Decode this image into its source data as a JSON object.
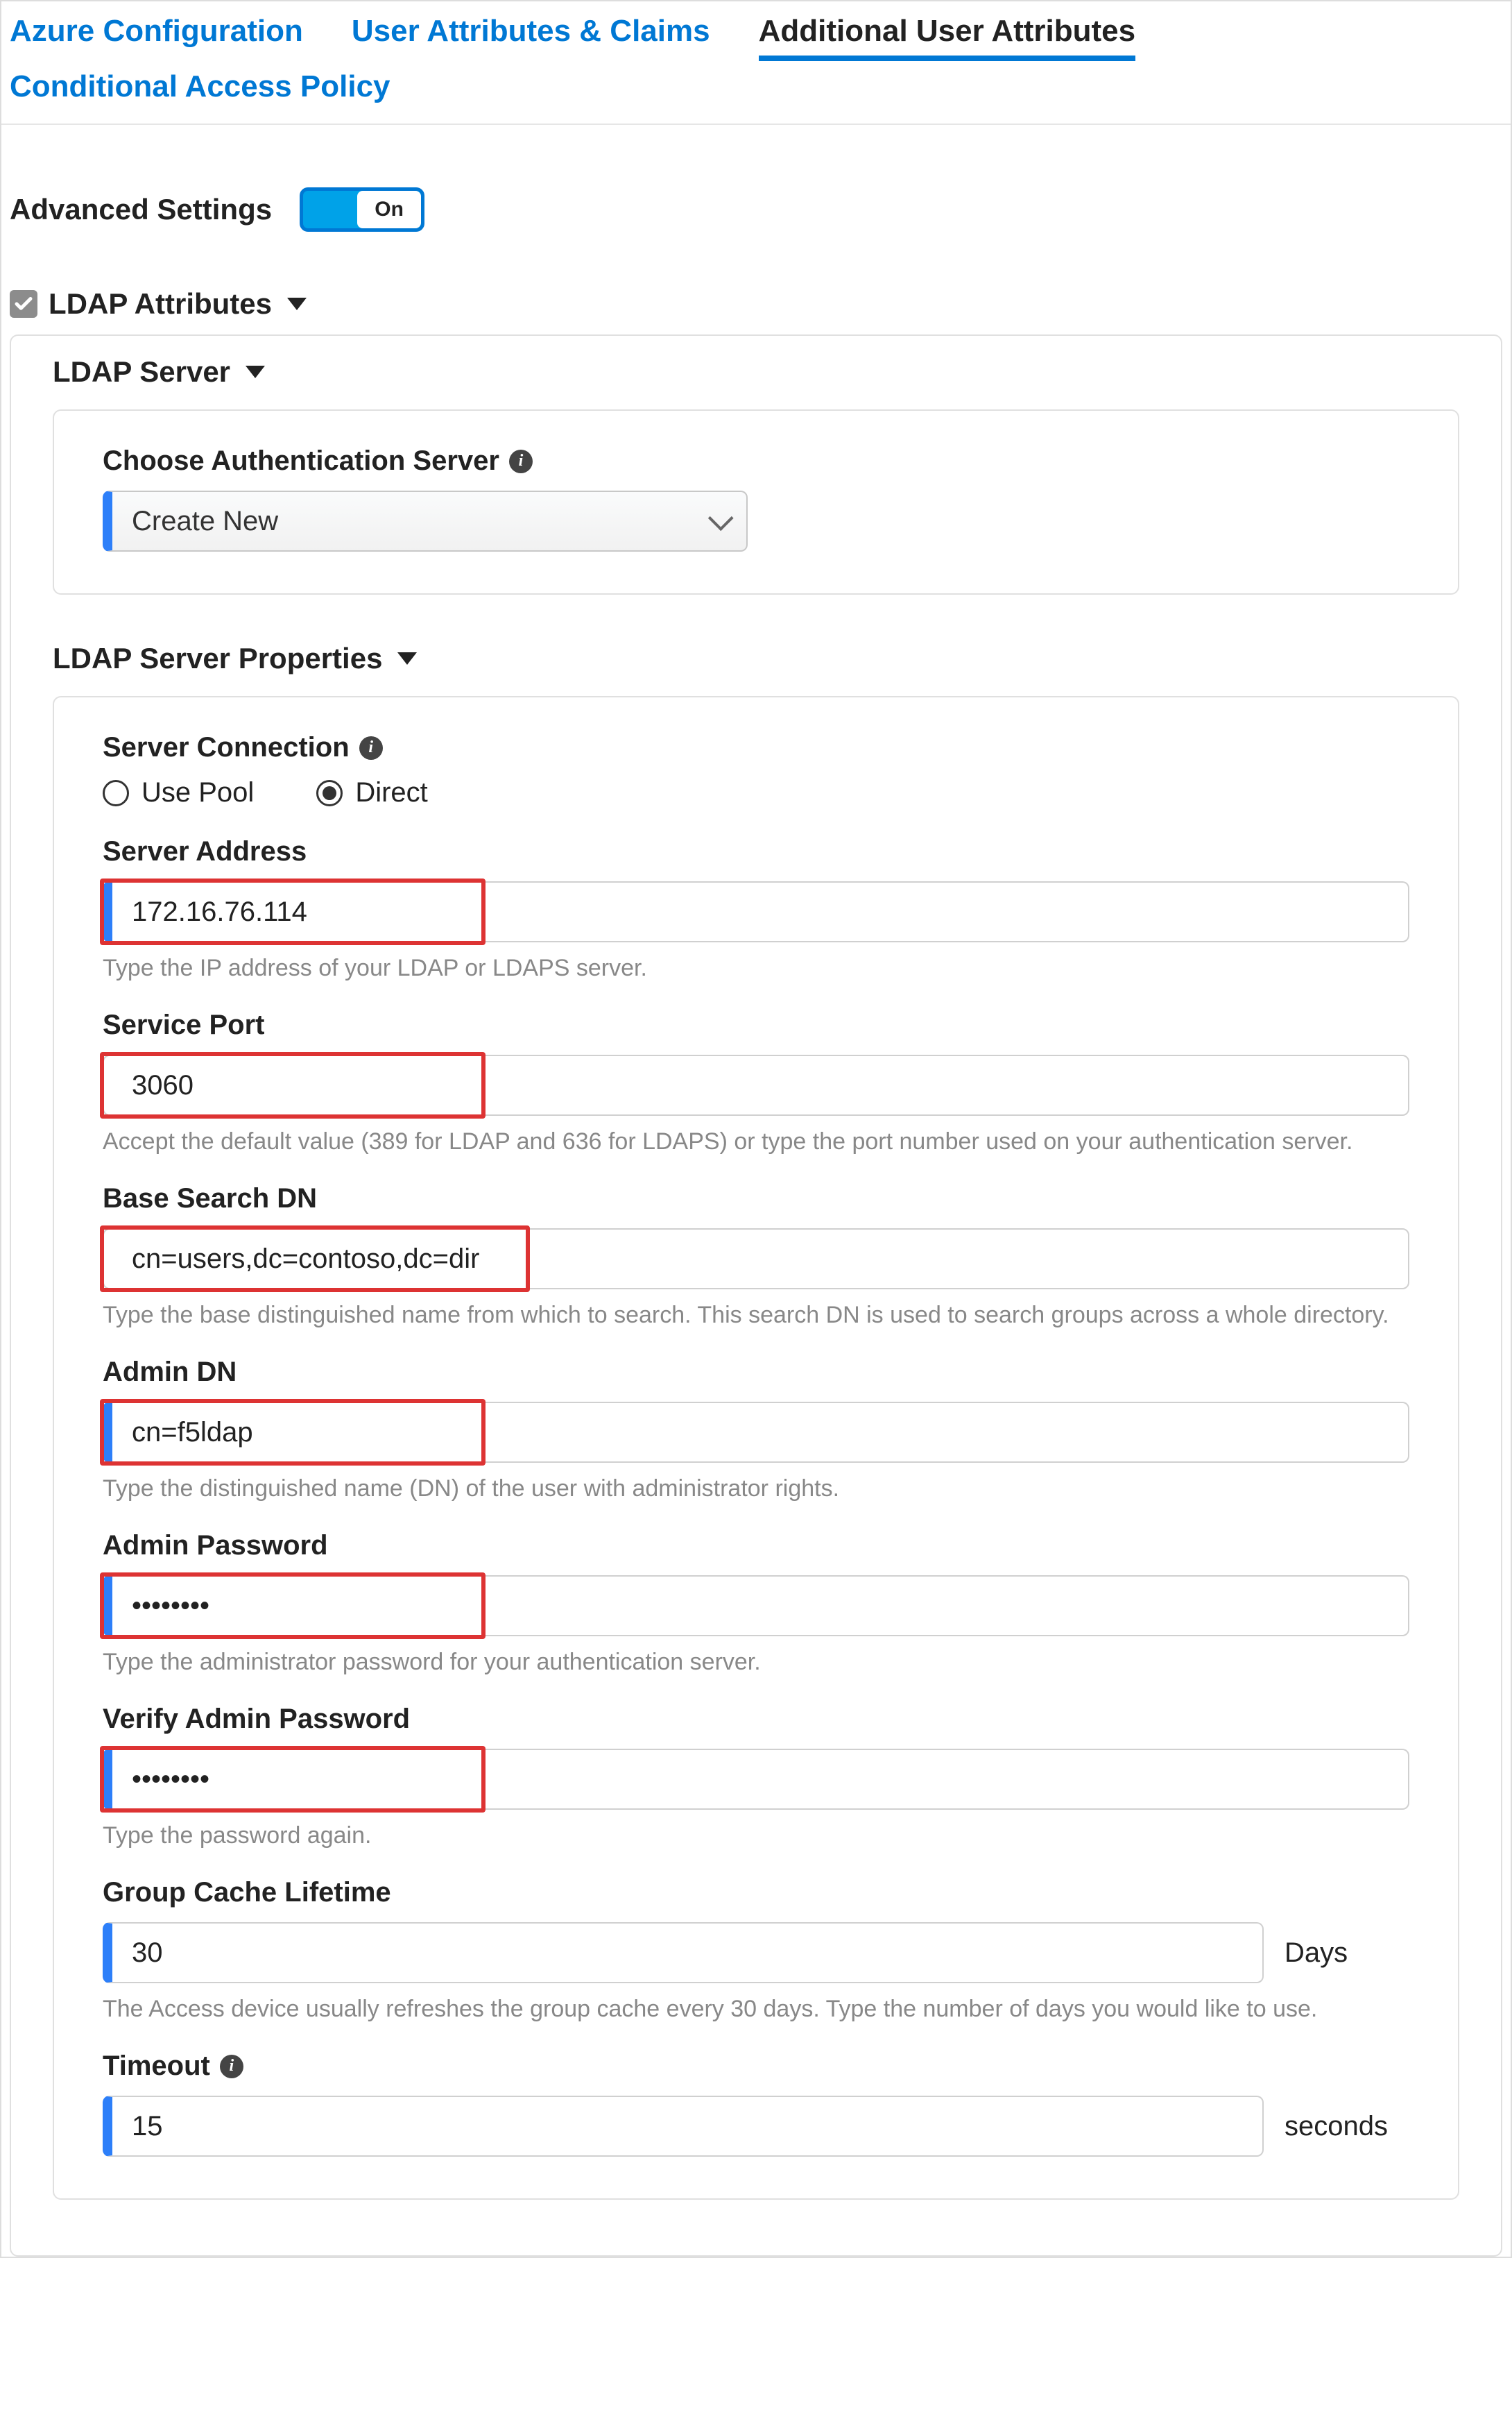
{
  "tabs": {
    "azure": "Azure Configuration",
    "claims": "User Attributes & Claims",
    "additional": "Additional User Attributes",
    "cap": "Conditional Access Policy"
  },
  "advanced": {
    "label": "Advanced Settings",
    "toggle_text": "On"
  },
  "ldap": {
    "title": "LDAP Attributes",
    "server_section": "LDAP Server",
    "auth_label": "Choose Authentication Server",
    "auth_selected": "Create New",
    "props_section": "LDAP Server Properties",
    "conn_label": "Server Connection",
    "conn_pool": "Use Pool",
    "conn_direct": "Direct",
    "addr_label": "Server Address",
    "addr_value": "172.16.76.114",
    "addr_help": "Type the IP address of your LDAP or LDAPS server.",
    "port_label": "Service Port",
    "port_value": "3060",
    "port_help": "Accept the default value (389 for LDAP and 636 for LDAPS) or type the port number used on your authentication server.",
    "basedn_label": "Base Search DN",
    "basedn_value": "cn=users,dc=contoso,dc=dir",
    "basedn_help": "Type the base distinguished name from which to search. This search DN is used to search groups across a whole directory.",
    "admindn_label": "Admin DN",
    "admindn_value": "cn=f5ldap",
    "admindn_help": "Type the distinguished name (DN) of the user with administrator rights.",
    "adminpw_label": "Admin Password",
    "adminpw_value": "••••••••",
    "adminpw_help": "Type the administrator password for your authentication server.",
    "verifypw_label": "Verify Admin Password",
    "verifypw_value": "••••••••",
    "verifypw_help": "Type the password again.",
    "cache_label": "Group Cache Lifetime",
    "cache_value": "30",
    "cache_unit": "Days",
    "cache_help": "The Access device usually refreshes the group cache every 30 days. Type the number of days you would like to use.",
    "timeout_label": "Timeout",
    "timeout_value": "15",
    "timeout_unit": "seconds"
  }
}
